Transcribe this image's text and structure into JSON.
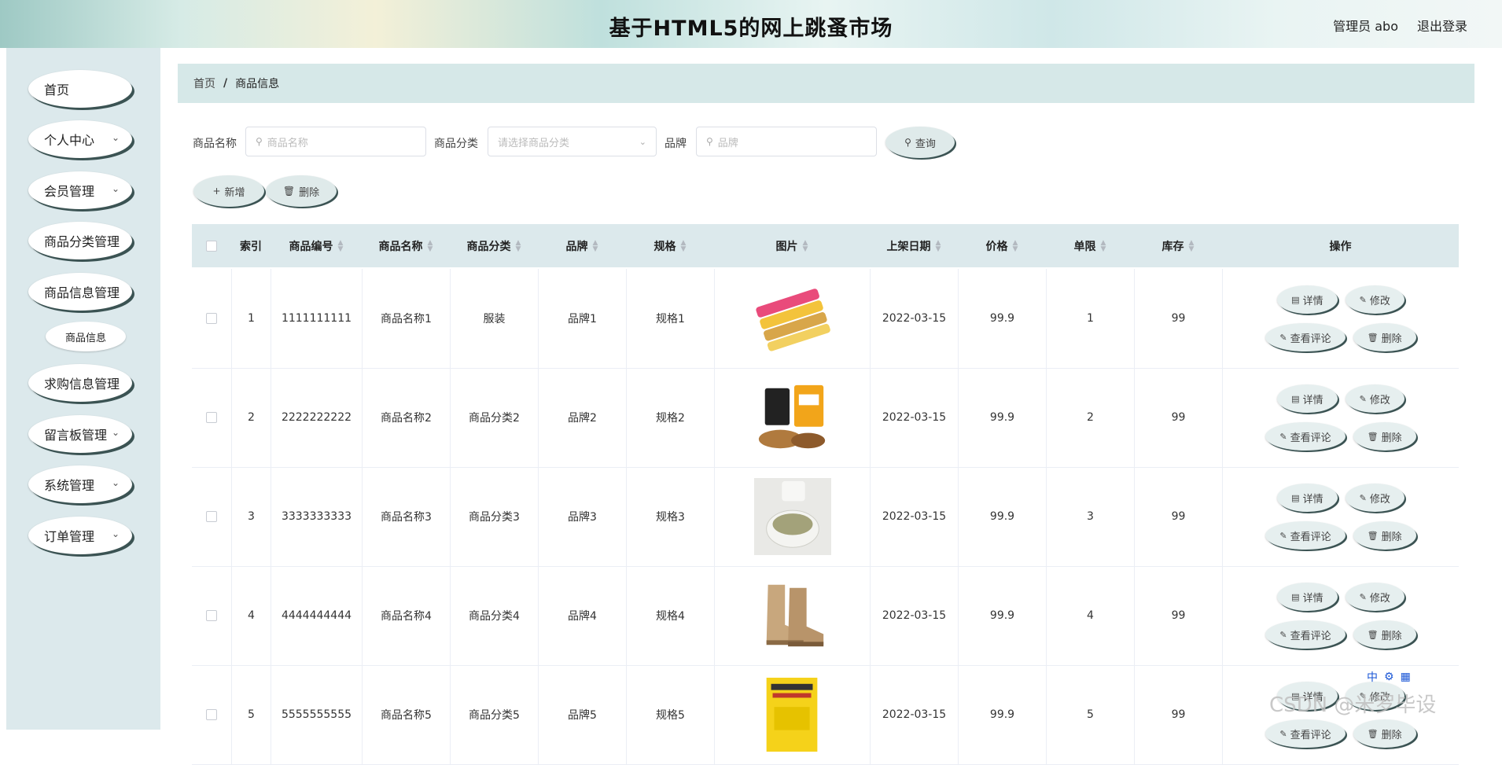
{
  "header": {
    "title": "基于HTML5的网上跳蚤市场",
    "user_label": "管理员 abo",
    "logout_label": "退出登录"
  },
  "sidebar": {
    "items": [
      {
        "label": "首页",
        "has_arrow": false
      },
      {
        "label": "个人中心",
        "has_arrow": true
      },
      {
        "label": "会员管理",
        "has_arrow": true
      },
      {
        "label": "商品分类管理",
        "has_arrow": false
      },
      {
        "label": "商品信息管理",
        "has_arrow": false
      },
      {
        "label": "求购信息管理",
        "has_arrow": false
      },
      {
        "label": "留言板管理",
        "has_arrow": true
      },
      {
        "label": "系统管理",
        "has_arrow": true
      },
      {
        "label": "订单管理",
        "has_arrow": true
      }
    ],
    "sub_item": "商品信息"
  },
  "breadcrumb": {
    "home": "首页",
    "separator": "/",
    "current": "商品信息"
  },
  "filters": {
    "name_label": "商品名称",
    "name_placeholder": "商品名称",
    "category_label": "商品分类",
    "category_placeholder": "请选择商品分类",
    "brand_label": "品牌",
    "brand_placeholder": "品牌",
    "search_button": "查询"
  },
  "actions": {
    "add_button": "新增",
    "delete_button": "删除"
  },
  "table": {
    "columns": [
      "索引",
      "商品编号",
      "商品名称",
      "商品分类",
      "品牌",
      "规格",
      "图片",
      "上架日期",
      "价格",
      "单限",
      "库存",
      "操作"
    ],
    "row_buttons": {
      "detail": "详情",
      "edit": "修改",
      "comments": "查看评论",
      "delete": "删除"
    },
    "rows": [
      {
        "index": "1",
        "code": "1111111111",
        "name": "商品名称1",
        "category": "服装",
        "brand": "品牌1",
        "spec": "规格1",
        "image": "snack-tubes",
        "date": "2022-03-15",
        "price": "99.9",
        "limit": "1",
        "stock": "99"
      },
      {
        "index": "2",
        "code": "2222222222",
        "name": "商品名称2",
        "category": "商品分类2",
        "brand": "品牌2",
        "spec": "规格2",
        "image": "nuts-pack",
        "date": "2022-03-15",
        "price": "99.9",
        "limit": "2",
        "stock": "99"
      },
      {
        "index": "3",
        "code": "3333333333",
        "name": "商品名称3",
        "category": "商品分类3",
        "brand": "品牌3",
        "spec": "规格3",
        "image": "cream-jar",
        "date": "2022-03-15",
        "price": "99.9",
        "limit": "3",
        "stock": "99"
      },
      {
        "index": "4",
        "code": "4444444444",
        "name": "商品名称4",
        "category": "商品分类4",
        "brand": "品牌4",
        "spec": "规格4",
        "image": "boots",
        "date": "2022-03-15",
        "price": "99.9",
        "limit": "4",
        "stock": "99"
      },
      {
        "index": "5",
        "code": "5555555555",
        "name": "商品名称5",
        "category": "商品分类5",
        "brand": "品牌5",
        "spec": "规格5",
        "image": "yellow-book",
        "date": "2022-03-15",
        "price": "99.9",
        "limit": "5",
        "stock": "99"
      }
    ]
  },
  "overlay": {
    "watermark": "CSDN @米罗毕设",
    "ime": "中"
  }
}
